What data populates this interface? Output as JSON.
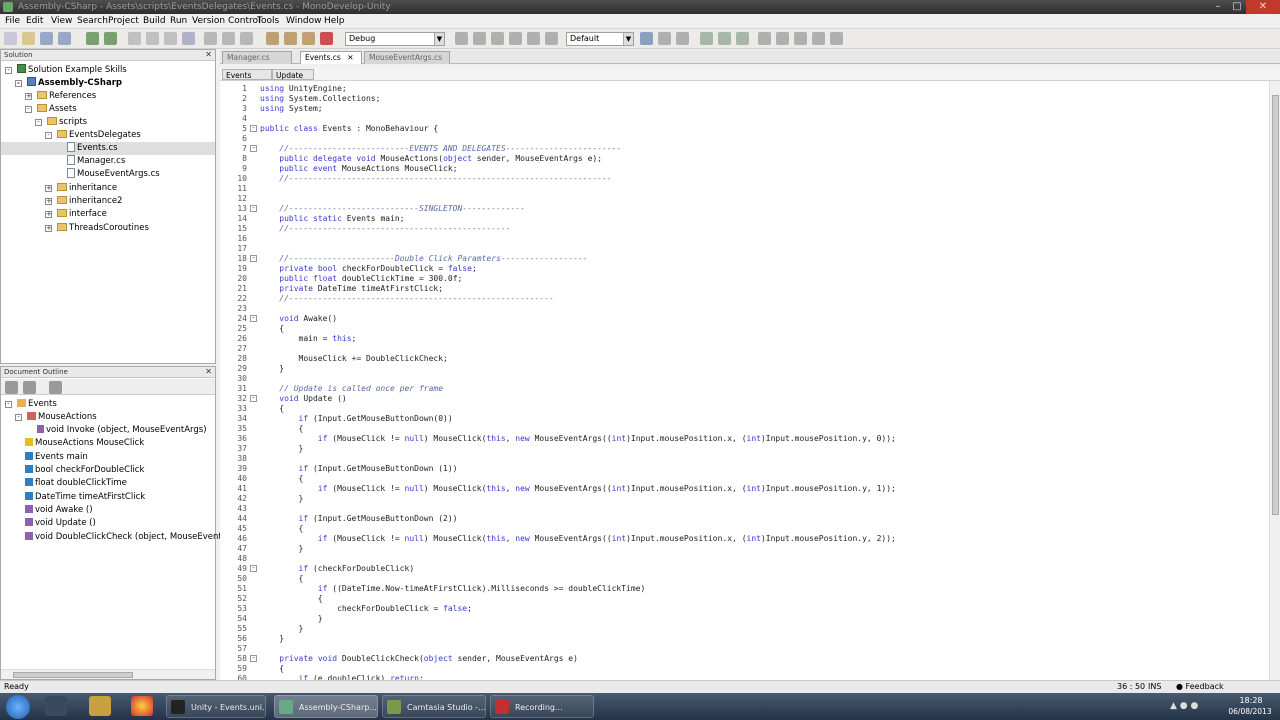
{
  "window": {
    "title": "Assembly-CSharp - Assets\\scripts\\EventsDelegates\\Events.cs - MonoDevelop-Unity"
  },
  "menu": [
    "File",
    "Edit",
    "View",
    "Search",
    "Project",
    "Build",
    "Run",
    "Version Control",
    "Tools",
    "Window",
    "Help"
  ],
  "toolbar": {
    "config": "Debug",
    "layout": "Default"
  },
  "solution_panel": {
    "header": "Solution",
    "items": [
      {
        "label": "Solution Example Skills",
        "icon": "solution-icon"
      },
      {
        "label": "Assembly-CSharp",
        "icon": "project-icon",
        "bold": true
      },
      {
        "label": "References",
        "icon": "folder-icon"
      },
      {
        "label": "Assets",
        "icon": "folder-icon"
      },
      {
        "label": "scripts",
        "icon": "folder-icon"
      },
      {
        "label": "EventsDelegates",
        "icon": "folder-icon"
      },
      {
        "label": "Events.cs",
        "icon": "csharp-file-icon"
      },
      {
        "label": "Manager.cs",
        "icon": "csharp-file-icon"
      },
      {
        "label": "MouseEventArgs.cs",
        "icon": "csharp-file-icon"
      },
      {
        "label": "inheritance",
        "icon": "folder-icon"
      },
      {
        "label": "inheritance2",
        "icon": "folder-icon"
      },
      {
        "label": "interface",
        "icon": "folder-icon"
      },
      {
        "label": "ThreadsCoroutines",
        "icon": "folder-icon"
      }
    ]
  },
  "outline_panel": {
    "header": "Document Outline",
    "items": [
      "Events",
      "MouseActions",
      "void Invoke (object, MouseEventArgs)",
      "MouseActions MouseClick",
      "Events main",
      "bool checkForDoubleClick",
      "float doubleClickTime",
      "DateTime timeAtFirstClick",
      "void Awake ()",
      "void Update ()",
      "void DoubleClickCheck (object, MouseEventArgs)"
    ]
  },
  "tabs": [
    "Manager.cs",
    "Events.cs",
    "MouseEventArgs.cs"
  ],
  "path_bar": [
    "Events",
    "Update ()"
  ],
  "code_lines": [
    "using UnityEngine;",
    "using System.Collections;",
    "using System;",
    "",
    "public class Events : MonoBehaviour {",
    "",
    "    //-------------------------EVENTS AND DELEGATES------------------------",
    "    public delegate void MouseActions(object sender, MouseEventArgs e);",
    "    public event MouseActions MouseClick;",
    "    //-------------------------------------------------------------------",
    "",
    "",
    "    //---------------------------SINGLETON-------------",
    "    public static Events main;",
    "    //----------------------------------------------",
    "",
    "",
    "    //----------------------Double Click Paramters------------------",
    "    private bool checkForDoubleClick = false;",
    "    public float doubleClickTime = 300.0f;",
    "    private DateTime timeAtFirstClick;",
    "    //-------------------------------------------------------",
    "",
    "    void Awake()",
    "    {",
    "        main = this;",
    "",
    "        MouseClick += DoubleClickCheck;",
    "    }",
    "",
    "    // Update is called once per frame",
    "    void Update ()",
    "    {",
    "        if (Input.GetMouseButtonDown(0))",
    "        {",
    "            if (MouseClick != null) MouseClick(this, new MouseEventArgs((int)Input.mousePosition.x, (int)Input.mousePosition.y, 0));",
    "        }",
    "",
    "        if (Input.GetMouseButtonDown (1))",
    "        {",
    "            if (MouseClick != null) MouseClick(this, new MouseEventArgs((int)Input.mousePosition.x, (int)Input.mousePosition.y, 1));",
    "        }",
    "",
    "        if (Input.GetMouseButtonDown (2))",
    "        {",
    "            if (MouseClick != null) MouseClick(this, new MouseEventArgs((int)Input.mousePosition.x, (int)Input.mousePosition.y, 2));",
    "        }",
    "",
    "        if (checkForDoubleClick)",
    "        {",
    "            if ((DateTime.Now-timeAtFirstClick).Milliseconds >= doubleClickTime)",
    "            {",
    "                checkForDoubleClick = false;",
    "            }",
    "        }",
    "    }",
    "",
    "    private void DoubleClickCheck(object sender, MouseEventArgs e)",
    "    {",
    "        if (e.doubleClick) return;"
  ],
  "status": {
    "left": "Ready",
    "position": "36 : 50",
    "mode": "INS",
    "feedback": "Feedback"
  },
  "taskbar": {
    "tasks": [
      "Unity - Events.uni...",
      "Assembly-CSharp...",
      "Camtasia Studio -...",
      "Recording..."
    ],
    "time": "18:28",
    "date": "06/08/2013"
  },
  "colors": {
    "keyword": "#3a3ad0",
    "comment": "#5a6aa8",
    "folder": "#e8c46a",
    "taskbar": "#243448"
  }
}
